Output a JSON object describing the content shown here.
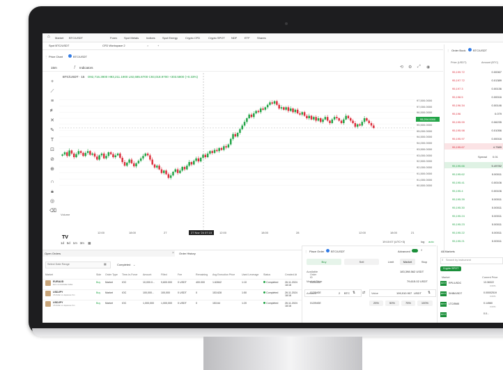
{
  "topbar": {
    "market_label": "Market",
    "ticker": "BTC/USDT",
    "menu": [
      "Forex",
      "Spot Metals",
      "Indices",
      "Spot Energy",
      "Crypto CFD",
      "Crypto SPOT",
      "NDF",
      "ETF",
      "Shares"
    ]
  },
  "tabs": [
    "Spot BTC/USDT",
    "CFD Workspace 2"
  ],
  "chart_panel": {
    "title": "Price Chart",
    "symbol": "BTC/USDT",
    "interval": "15m",
    "indicators_label": "Indicators",
    "legend_symbol": "BTC/USDT · 15",
    "legend_values": "O92,716.3900 H93,211.1900 L92,685.8700 C93,018.9700 +303.5800 (+0.33%)",
    "last_price": "95,204.0000",
    "volume_label": "Volume",
    "time_ticks": [
      "12:00",
      "18:00",
      "27",
      "12:00",
      "18:00",
      "28",
      "12:00",
      "18:00",
      "21"
    ],
    "crosshair_time": "27 Nov '24  07:15",
    "ranges": [
      "1d",
      "5d",
      "1m",
      "3m"
    ],
    "clock": "19:10:07 (UTC+3)",
    "log_label": "log",
    "auto_label": "auto"
  },
  "chart_data": {
    "type": "candlestick",
    "title": "",
    "xlabel": "",
    "ylabel": "",
    "ylim": [
      90000,
      98000
    ],
    "yticks": [
      "97,500.0000",
      "97,000.0000",
      "96,500.0000",
      "96,000.0000",
      "95,500.0000",
      "95,000.0000",
      "94,500.0000",
      "94,000.0000",
      "93,500.0000",
      "93,000.0000",
      "92,500.0000",
      "92,000.0000",
      "91,500.0000",
      "91,000.0000",
      "90,500.0000"
    ],
    "close": [
      93019,
      93200,
      92900,
      93350,
      93100,
      92800,
      93050,
      93300,
      93150,
      92900,
      93150,
      93300,
      93000,
      93100,
      92850,
      92600,
      92950,
      93100,
      92700,
      92900,
      93200,
      93050,
      92800,
      92950,
      93100,
      92750,
      92400,
      92100,
      92350,
      92600,
      92300,
      92050,
      92300,
      92500,
      92700,
      92900,
      93100,
      92950,
      92600,
      92200,
      91950,
      92100,
      91800,
      91500,
      91700,
      91400,
      91100,
      91300,
      91600,
      91800,
      91500,
      91700,
      92000,
      91800,
      92100,
      92400,
      92200,
      92500,
      92700,
      92450,
      92750,
      93000,
      92800,
      93100,
      93300,
      93150,
      93400,
      93300,
      93550,
      93400,
      93700,
      93600,
      93850,
      94300,
      94700,
      94500,
      94800,
      95100,
      95400,
      95700,
      96000,
      96300,
      96100,
      96400,
      96600,
      96500,
      96800,
      96700,
      96900,
      97100,
      97300,
      97200,
      97400,
      97100,
      96800,
      96900,
      96700,
      96900,
      96600,
      96800,
      96500,
      96700,
      96400,
      96300,
      96500,
      96200,
      96000,
      96200,
      95900,
      96100,
      95800,
      96000,
      95700,
      95900,
      96100,
      95800,
      95600,
      95900,
      96100,
      96000,
      95800,
      95600,
      95900,
      96200,
      96000,
      95800,
      95600,
      95300,
      95500,
      95400,
      95700,
      96000,
      95800,
      95600,
      95400,
      95200
    ]
  },
  "order_book": {
    "title": "Order Book",
    "symbol": "BTC/USDT",
    "col_price": "Price (USDT)",
    "col_amount": "Amount (BTC)",
    "asks": [
      {
        "p": "95,199.72",
        "a": "0.00067"
      },
      {
        "p": "95,197.72",
        "a": "0.01389"
      },
      {
        "p": "95,197.3",
        "a": "0.00136"
      },
      {
        "p": "95,198.5",
        "a": "0.00016"
      },
      {
        "p": "95,196.34",
        "a": "0.00146"
      },
      {
        "p": "95,196",
        "a": "0.079"
      },
      {
        "p": "95,195.99",
        "a": "0.06235"
      },
      {
        "p": "95,195.98",
        "a": "0.01056"
      },
      {
        "p": "95,195.97",
        "a": "0.00016"
      },
      {
        "p": "95,195.67",
        "a": "4.7589"
      }
    ],
    "spread_label": "Spread",
    "spread_value": "0.01",
    "bids": [
      {
        "p": "95,195.66",
        "a": "5.49782"
      },
      {
        "p": "95,195.62",
        "a": "0.00011"
      },
      {
        "p": "95,195.41",
        "a": "0.00106"
      },
      {
        "p": "95,195.4",
        "a": "0.00106"
      },
      {
        "p": "95,195.39",
        "a": "0.00011"
      },
      {
        "p": "95,195.30",
        "a": "0.00011"
      },
      {
        "p": "95,195.24",
        "a": "0.00011"
      },
      {
        "p": "95,195.23",
        "a": "0.00011"
      },
      {
        "p": "95,195.22",
        "a": "0.00011"
      },
      {
        "p": "95,195.21",
        "a": "0.00011"
      }
    ]
  },
  "orders": {
    "tab_open": "Open Orders",
    "tab_history": "Order History",
    "date_placeholder": "Select Date Range",
    "status_filter": "Completed",
    "headers": [
      "Market",
      "Side",
      "Order Type",
      "Time-In-Force",
      "Amount",
      "Filled",
      "Fee",
      "Remaining",
      "Avg Execution Price",
      "Used Leverage",
      "Status",
      "Created At",
      "Order ID"
    ],
    "rows": [
      {
        "sym": "EURAUD",
        "desc": "Euro vs Australian Dollar",
        "side": "Buy",
        "type": "Market",
        "tif": "IOC",
        "amount": "10,000.0...",
        "filled": "9,600.000",
        "fee": "0 USDT",
        "remaining": "400.000",
        "avg": "1.62842",
        "lev": "1:10",
        "status": "Completed",
        "created": "26.11.2024 18:16",
        "id": "0120NGE"
      },
      {
        "sym": "USDJPY",
        "desc": "US Dollar vs Japanese Yen",
        "side": "Buy",
        "type": "Market",
        "tif": "IOC",
        "amount": "100,000...",
        "filled": "100,000",
        "fee": "0 USDT",
        "remaining": "0",
        "avg": "153.628",
        "lev": "1:50",
        "status": "Completed",
        "created": "26.11.2024 18:16",
        "id": "0120NGE"
      },
      {
        "sym": "USDJPY",
        "desc": "US Dollar vs Japanese Yen",
        "side": "Buy",
        "type": "Market",
        "tif": "IOC",
        "amount": "1,000,000",
        "filled": "1,000,000",
        "fee": "0 USDT",
        "remaining": "0",
        "avg": "153.64",
        "lev": "1:20",
        "status": "Completed",
        "created": "26.11.2024 18:16",
        "id": "0120NGE"
      }
    ]
  },
  "place_order": {
    "title": "Place Order",
    "symbol": "BTC/USDT",
    "advanced_label": "Advanced",
    "buy": "Buy",
    "sell": "Sell",
    "order_types": [
      "Limit",
      "Market",
      "Stop"
    ],
    "available_label": "Available",
    "available_value": "183,398.562 USDT",
    "market_price_label": "Market Price",
    "market_price_value": "79,615.02 USDT",
    "amount_label": "Amount",
    "amount_value": "2",
    "amount_unit": "BTC",
    "value_label": "Value",
    "value_amount": "199,910.907",
    "value_unit": "USDT",
    "percents": [
      "25%",
      "50%",
      "75%",
      "100%"
    ]
  },
  "markets": {
    "title": "All Markets",
    "search_placeholder": "Search by instrument",
    "chip": "Crypto SPOT",
    "col_market": "Market",
    "col_price": "Current Price",
    "rows": [
      {
        "badge": "SPOT",
        "sym": "RPL/USDC",
        "price": "13.36322",
        "chg": "0.00%"
      },
      {
        "badge": "SPOT",
        "sym": "SHIB/USDT",
        "price": "0.00002519",
        "chg": "0.00%"
      },
      {
        "badge": "SPOT",
        "sym": "LTC/BNB",
        "price": "0.14560",
        "chg": "0.00%"
      },
      {
        "badge": "SPOT",
        "sym": "",
        "price": "0.0...",
        "chg": ""
      }
    ]
  },
  "colors": {
    "up": "#22a447",
    "down": "#dc2d3b",
    "accent": "#1b8f3a"
  }
}
